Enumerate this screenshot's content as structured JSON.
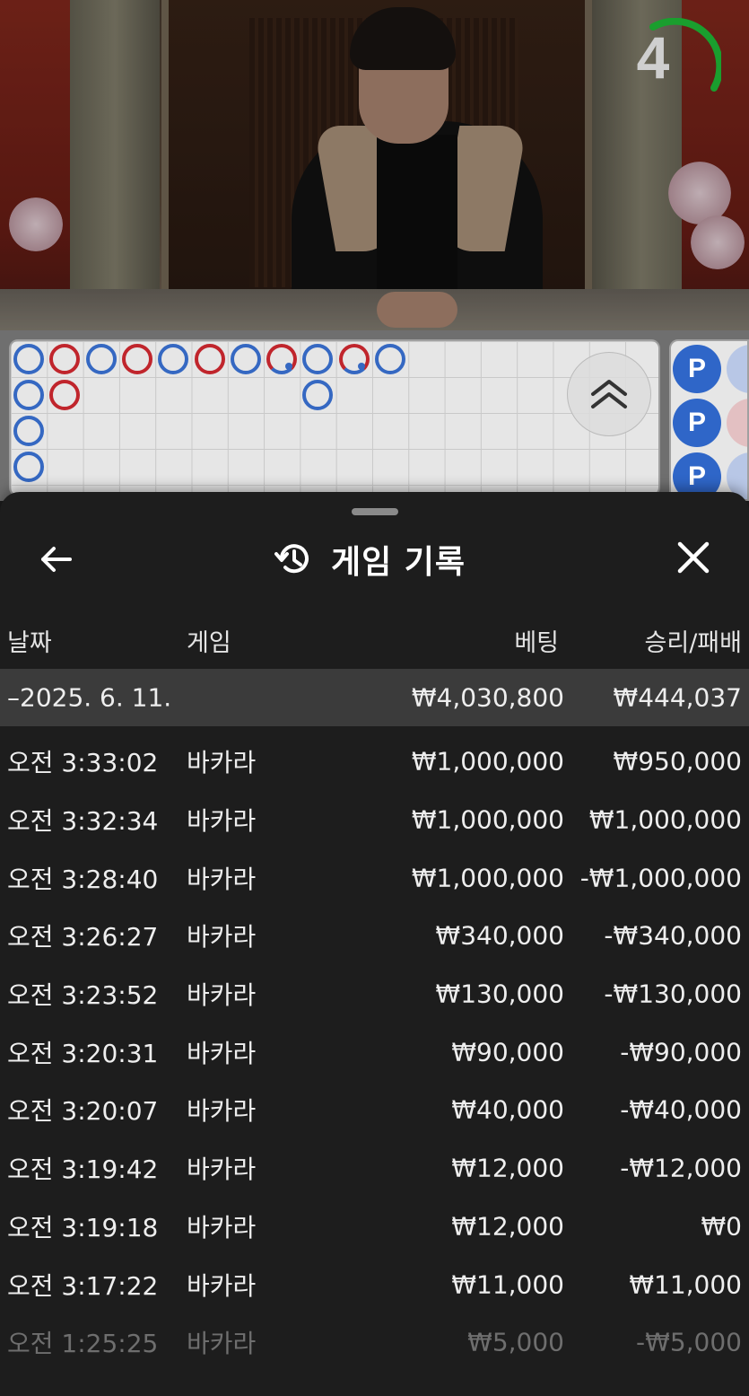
{
  "timer": {
    "count": "4",
    "ring_color": "#1a9e2e"
  },
  "roadmap": {
    "beads": [
      [
        "P",
        "P",
        "P",
        "P"
      ],
      [
        "B",
        "B"
      ],
      [
        "P"
      ],
      [
        "B"
      ],
      [
        "P"
      ],
      [
        "B"
      ],
      [
        "P"
      ],
      [
        "half-B"
      ],
      [
        "P",
        "P"
      ],
      [
        "half-B"
      ],
      [
        "P"
      ]
    ],
    "side_label": "P"
  },
  "sheet": {
    "title": "게임 기록",
    "columns": {
      "date": "날짜",
      "game": "게임",
      "bet": "베팅",
      "winloss": "승리/패배"
    },
    "day": {
      "date": "–2025. 6. 11.",
      "bet": "₩4,030,800",
      "winloss": "₩444,037"
    },
    "rows": [
      {
        "time": "오전 3:33:02",
        "game": "바카라",
        "bet": "₩1,000,000",
        "winloss": "₩950,000"
      },
      {
        "time": "오전 3:32:34",
        "game": "바카라",
        "bet": "₩1,000,000",
        "winloss": "₩1,000,000"
      },
      {
        "time": "오전 3:28:40",
        "game": "바카라",
        "bet": "₩1,000,000",
        "winloss": "-₩1,000,000"
      },
      {
        "time": "오전 3:26:27",
        "game": "바카라",
        "bet": "₩340,000",
        "winloss": "-₩340,000"
      },
      {
        "time": "오전 3:23:52",
        "game": "바카라",
        "bet": "₩130,000",
        "winloss": "-₩130,000"
      },
      {
        "time": "오전 3:20:31",
        "game": "바카라",
        "bet": "₩90,000",
        "winloss": "-₩90,000"
      },
      {
        "time": "오전 3:20:07",
        "game": "바카라",
        "bet": "₩40,000",
        "winloss": "-₩40,000"
      },
      {
        "time": "오전 3:19:42",
        "game": "바카라",
        "bet": "₩12,000",
        "winloss": "-₩12,000"
      },
      {
        "time": "오전 3:19:18",
        "game": "바카라",
        "bet": "₩12,000",
        "winloss": "₩0"
      },
      {
        "time": "오전 3:17:22",
        "game": "바카라",
        "bet": "₩11,000",
        "winloss": "₩11,000"
      },
      {
        "time": "오전 1:25:25",
        "game": "바카라",
        "bet": "₩5,000",
        "winloss": "-₩5,000"
      }
    ]
  },
  "icons": {
    "back": "arrow-left-icon",
    "history": "history-icon",
    "close": "close-icon",
    "expand": "chevron-double-up-icon"
  },
  "colors": {
    "player_blue": "#3568c2",
    "banker_red": "#c0252c",
    "sheet_bg": "#1d1d1d",
    "day_row_bg": "#3b3b3b"
  }
}
